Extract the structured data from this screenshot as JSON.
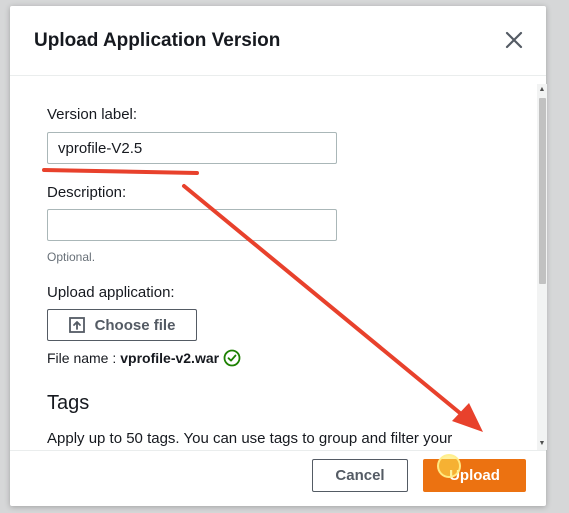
{
  "dialog": {
    "title": "Upload Application Version"
  },
  "form": {
    "version_label": "Version label:",
    "version_value": "vprofile-V2.5",
    "description_label": "Description:",
    "description_value": "",
    "description_hint": "Optional.",
    "upload_label": "Upload application:",
    "choose_file_label": "Choose file",
    "file_name_prefix": "File name :",
    "file_name": "vprofile-v2.war"
  },
  "tags": {
    "title": "Tags",
    "description": "Apply up to 50 tags. You can use tags to group and filter your"
  },
  "footer": {
    "cancel_label": "Cancel",
    "upload_label": "Upload"
  },
  "colors": {
    "primary": "#ec7211",
    "annotation": "#e8412c",
    "success": "#1d8102"
  },
  "icons": {
    "close": "close-icon",
    "upload": "upload-icon",
    "check": "check-circle-icon"
  }
}
